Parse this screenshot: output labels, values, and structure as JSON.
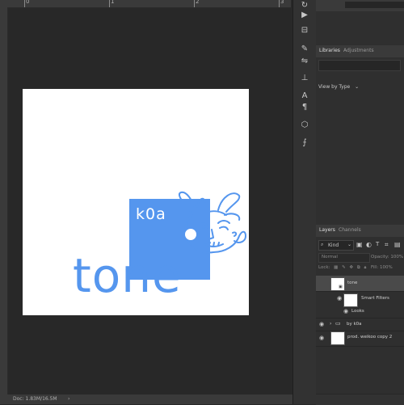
{
  "ruler": {
    "marks": [
      "0",
      "1",
      "2",
      "3"
    ]
  },
  "canvas": {
    "k0a_text": "k0a",
    "tone_text": "tone",
    "accent_color": "#5596ee"
  },
  "status_bar": {
    "doc_info": "Doc: 1.83M/16.5M",
    "arrow": "›"
  },
  "toolbar": {
    "tools": [
      "rotate-icon",
      "play-icon",
      "adjust-icon",
      "brush-icon",
      "sliders-icon",
      "stamp-icon",
      "type-icon",
      "paragraph-icon",
      "cube-icon",
      "path-icon"
    ]
  },
  "libraries": {
    "tabs": [
      "Libraries",
      "Adjustments"
    ],
    "search_placeholder": "",
    "view_by": "View by Type"
  },
  "layers": {
    "tabs": [
      "Layers",
      "Channels"
    ],
    "filter_kind": "Kind",
    "blend_mode": "Normal",
    "opacity_label": "Opacity:",
    "opacity_value": "100%",
    "lock_label": "Lock:",
    "fill_label": "Fill:",
    "fill_value": "100%",
    "rows": [
      {
        "name": "tone"
      },
      {
        "name": "Smart Filters"
      },
      {
        "name": "Looks"
      },
      {
        "name": "by k0a"
      },
      {
        "name": "prod. weikoo copy 2"
      }
    ]
  }
}
